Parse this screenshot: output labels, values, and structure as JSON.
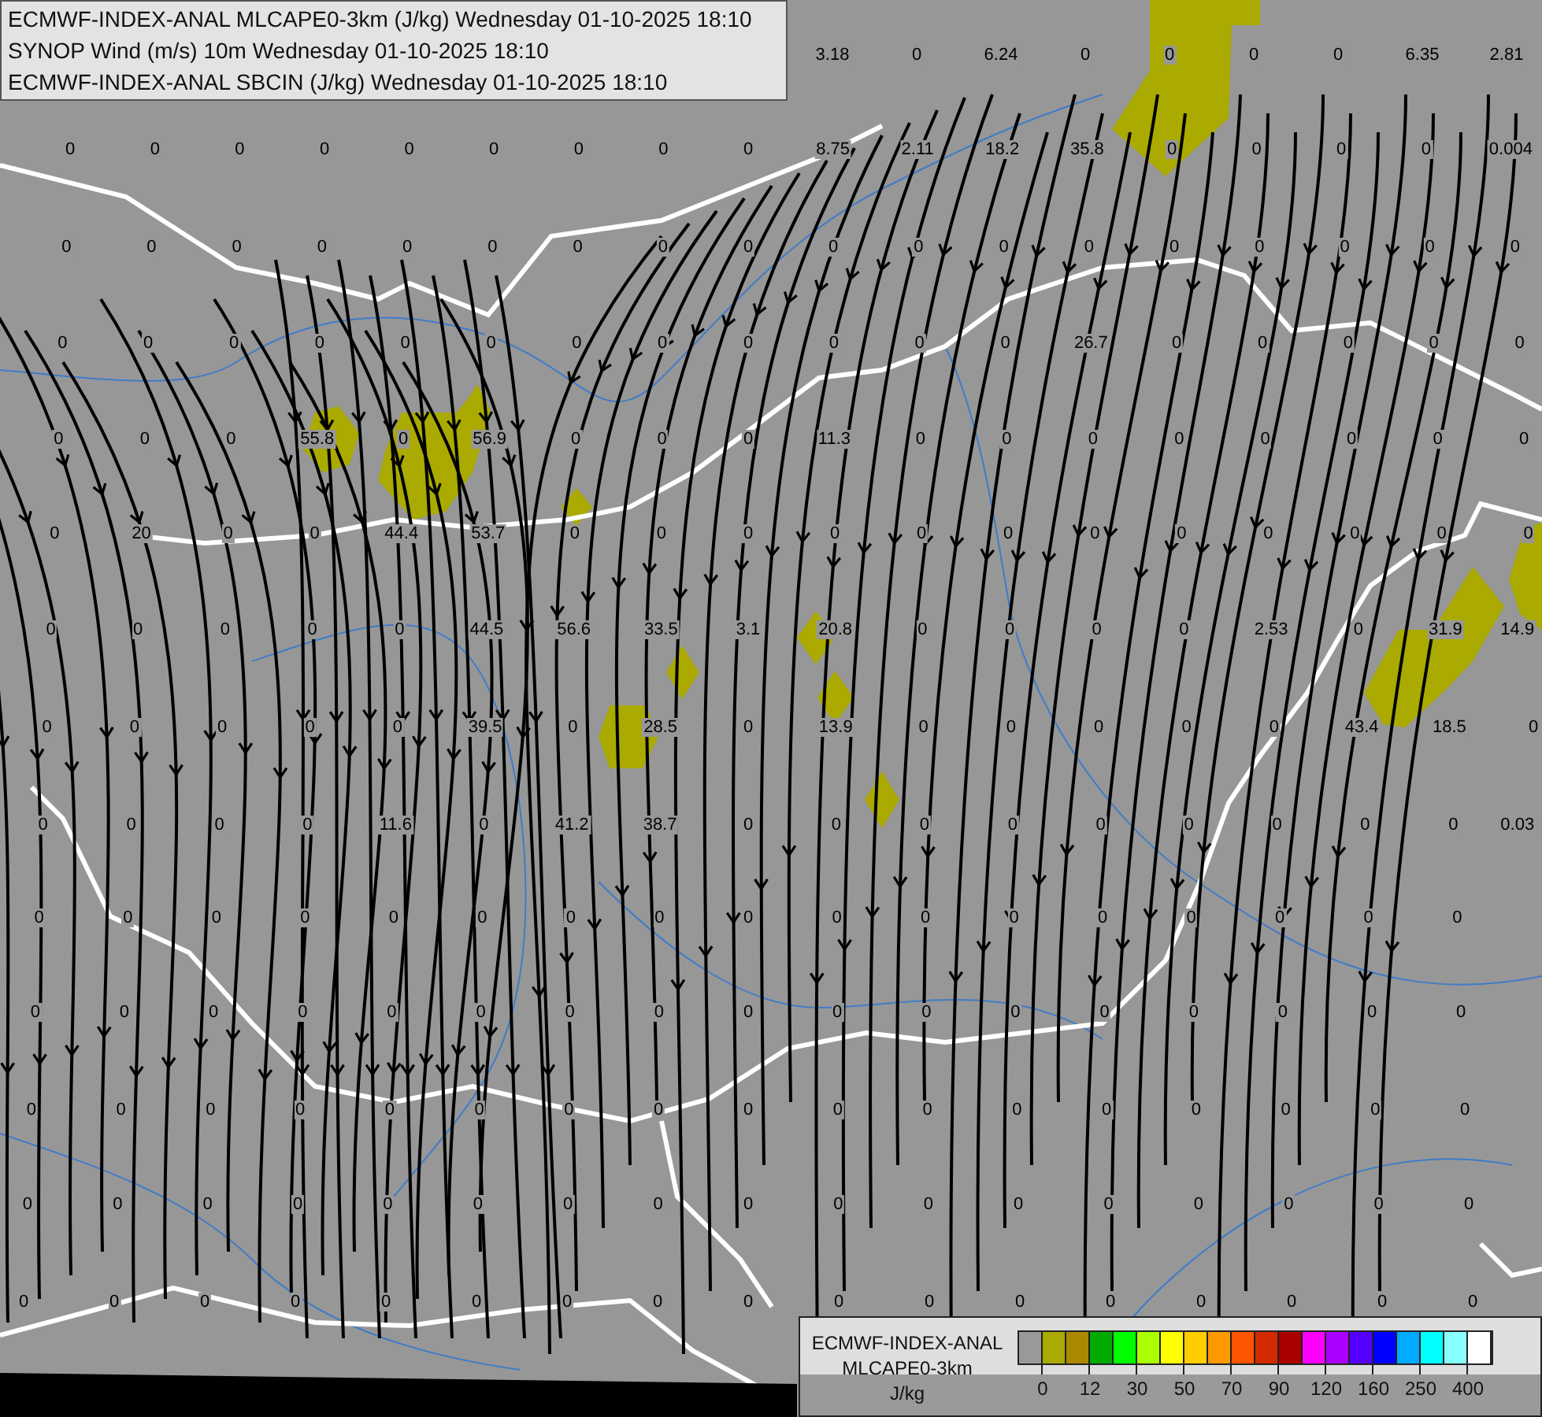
{
  "header": {
    "lines": [
      "ECMWF-INDEX-ANAL MLCAPE0-3km (J/kg) Wednesday 01-10-2025 18:10",
      "SYNOP Wind (m/s) 10m Wednesday 01-10-2025 18:10",
      "ECMWF-INDEX-ANAL SBCIN (J/kg) Wednesday 01-10-2025 18:10"
    ]
  },
  "top_row_values": [
    "3.18",
    "0",
    "6.24",
    "0",
    "0",
    "0",
    "0",
    "6.35",
    "2.81"
  ],
  "grid_values": [
    [
      "0",
      "0",
      "0",
      "0",
      "0",
      "0",
      "0",
      "0",
      "0",
      "8.75",
      "2.11",
      "18.2",
      "35.8",
      "0",
      "0",
      "0",
      "0",
      "0.004"
    ],
    [
      "0",
      "0",
      "0",
      "0",
      "0",
      "0",
      "0",
      "0",
      "0",
      "0",
      "0",
      "0",
      "0",
      "0",
      "0",
      "0",
      "0",
      "0"
    ],
    [
      "0",
      "0",
      "0",
      "0",
      "0",
      "0",
      "0",
      "0",
      "0",
      "0",
      "0",
      "0",
      "26.7",
      "0",
      "0",
      "0",
      "0",
      "0"
    ],
    [
      "0",
      "0",
      "0",
      "55.8",
      "0",
      "56.9",
      "0",
      "0",
      "0",
      "11.3",
      "0",
      "0",
      "0",
      "0",
      "0",
      "0",
      "0",
      "0"
    ],
    [
      "0",
      "20",
      "0",
      "0",
      "44.4",
      "53.7",
      "0",
      "0",
      "0",
      "0",
      "0",
      "0",
      "0",
      "0",
      "0",
      "0",
      "0",
      "0"
    ],
    [
      "0",
      "0",
      "0",
      "0",
      "0",
      "44.5",
      "56.6",
      "33.5",
      "3.1",
      "20.8",
      "0",
      "0",
      "0",
      "0",
      "2.53",
      "0",
      "31.9",
      "14.9"
    ],
    [
      "0",
      "0",
      "0",
      "0",
      "0",
      "39.5",
      "0",
      "28.5",
      "0",
      "13.9",
      "0",
      "0",
      "0",
      "0",
      "0",
      "43.4",
      "18.5",
      "0"
    ],
    [
      "0",
      "0",
      "0",
      "0",
      "11.6",
      "0",
      "41.2",
      "38.7",
      "0",
      "0",
      "0",
      "0",
      "0",
      "0",
      "0",
      "0",
      "0",
      "0.03"
    ],
    [
      "0",
      "0",
      "0",
      "0",
      "0",
      "0",
      "0",
      "0",
      "0",
      "0",
      "0",
      "0",
      "0",
      "0",
      "0",
      "0",
      "0"
    ],
    [
      "0",
      "0",
      "0",
      "0",
      "0",
      "0",
      "0",
      "0",
      "0",
      "0",
      "0",
      "0",
      "0",
      "0",
      "0",
      "0",
      "0"
    ],
    [
      "0",
      "0",
      "0",
      "0",
      "0",
      "0",
      "0",
      "0",
      "0",
      "0",
      "0",
      "0",
      "0",
      "0",
      "0",
      "0",
      "0"
    ],
    [
      "0",
      "0",
      "0",
      "0",
      "0",
      "0",
      "0",
      "0",
      "0",
      "0",
      "0",
      "0",
      "0",
      "0",
      "0",
      "0",
      "0"
    ],
    [
      "0",
      "0",
      "0",
      "0",
      "0",
      "0",
      "0",
      "0",
      "0",
      "0",
      "0",
      "0",
      "0",
      "0",
      "0",
      "0",
      "0"
    ]
  ],
  "legend": {
    "title_lines": [
      "ECMWF-INDEX-ANAL",
      "MLCAPE0-3km",
      "J/kg"
    ],
    "swatches": [
      {
        "color": "#999999"
      },
      {
        "color": "#aaaa00"
      },
      {
        "color": "#aa8800"
      },
      {
        "color": "#00aa00"
      },
      {
        "color": "#00ff00"
      },
      {
        "color": "#aaff00"
      },
      {
        "color": "#ffff00"
      },
      {
        "color": "#ffcc00"
      },
      {
        "color": "#ff9900"
      },
      {
        "color": "#ff5500"
      },
      {
        "color": "#d42a00"
      },
      {
        "color": "#aa0000"
      },
      {
        "color": "#ff00ff"
      },
      {
        "color": "#aa00ff"
      },
      {
        "color": "#5500ff"
      },
      {
        "color": "#0000ff"
      },
      {
        "color": "#00aaff"
      },
      {
        "color": "#00ffff"
      },
      {
        "color": "#88ffff"
      },
      {
        "color": "#ffffff"
      }
    ],
    "ticks": [
      "0",
      "12",
      "30",
      "50",
      "70",
      "90",
      "120",
      "160",
      "250",
      "400"
    ]
  }
}
